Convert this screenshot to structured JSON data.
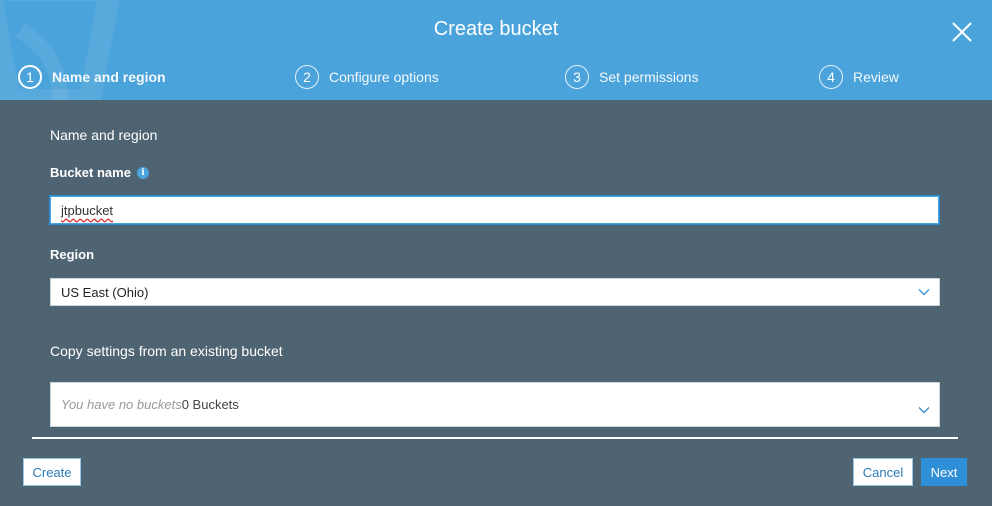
{
  "dialog": {
    "title": "Create bucket"
  },
  "steps": [
    {
      "number": "1",
      "label": "Name and region",
      "active": true
    },
    {
      "number": "2",
      "label": "Configure options",
      "active": false
    },
    {
      "number": "3",
      "label": "Set permissions",
      "active": false
    },
    {
      "number": "4",
      "label": "Review",
      "active": false
    }
  ],
  "form": {
    "section_title": "Name and region",
    "bucket_name": {
      "label": "Bucket name",
      "info_icon": "i",
      "value": "jtpbucket"
    },
    "region": {
      "label": "Region",
      "value": "US East (Ohio)"
    },
    "copy_settings": {
      "label": "Copy settings from an existing bucket",
      "placeholder": "You have no buckets",
      "count_text": "0 Buckets"
    }
  },
  "footer": {
    "create_label": "Create",
    "cancel_label": "Cancel",
    "next_label": "Next"
  },
  "colors": {
    "header": "#4aa3db",
    "body": "#4f6472",
    "primary_button": "#2e8fd6"
  }
}
